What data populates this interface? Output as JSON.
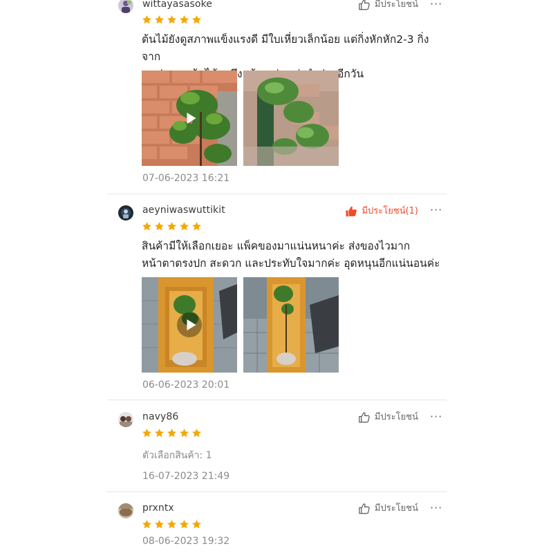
{
  "colors": {
    "star": "#f6a700",
    "helpful_active": "#ee4d2d",
    "helpful_default": "#555555",
    "date": "#8a8a8a",
    "divider": "#e6e6e6"
  },
  "reviews": [
    {
      "username": "wittayasasoke",
      "rating": 5,
      "helpful_label": "มีประโยชน์",
      "helpful_active": false,
      "more_label": "···",
      "comment_line1": "ต้นไม้ยังดูสภาพแข็งแรงดี มีใบเหี่ยวเล็กน้อย แต่กิ่งหักหัก2-3 กิ่งจาก",
      "comment_line2": "ขนส่ง และต้นไม้มาถึงแล้ว แต่ขนส่งนำจ่ายอีกวัน",
      "media": [
        "video",
        "image"
      ],
      "date": "07-06-2023 16:21"
    },
    {
      "username": "aeyniwaswuttikit",
      "rating": 5,
      "helpful_label": "มีประโยชน์(1)",
      "helpful_active": true,
      "more_label": "···",
      "comment_line1": "สินค้ามีให้เลือกเยอะ แพ็คของมาแน่นหนาค่ะ ส่งของไวมาก",
      "comment_line2": "หน้าตาตรงปก สะดวก และประทับใจมากค่ะ อุดหนุนอีกแน่นอนค่ะ",
      "media": [
        "video",
        "image"
      ],
      "date": "06-06-2023 20:01"
    },
    {
      "username": "navy86",
      "rating": 5,
      "helpful_label": "มีประโยชน์",
      "helpful_active": false,
      "more_label": "···",
      "variation": "ตัวเลือกสินค้า: 1",
      "date": "16-07-2023 21:49"
    },
    {
      "username": "prxntx",
      "rating": 5,
      "helpful_label": "มีประโยชน์",
      "helpful_active": false,
      "more_label": "···",
      "date": "08-06-2023 19:32"
    }
  ]
}
